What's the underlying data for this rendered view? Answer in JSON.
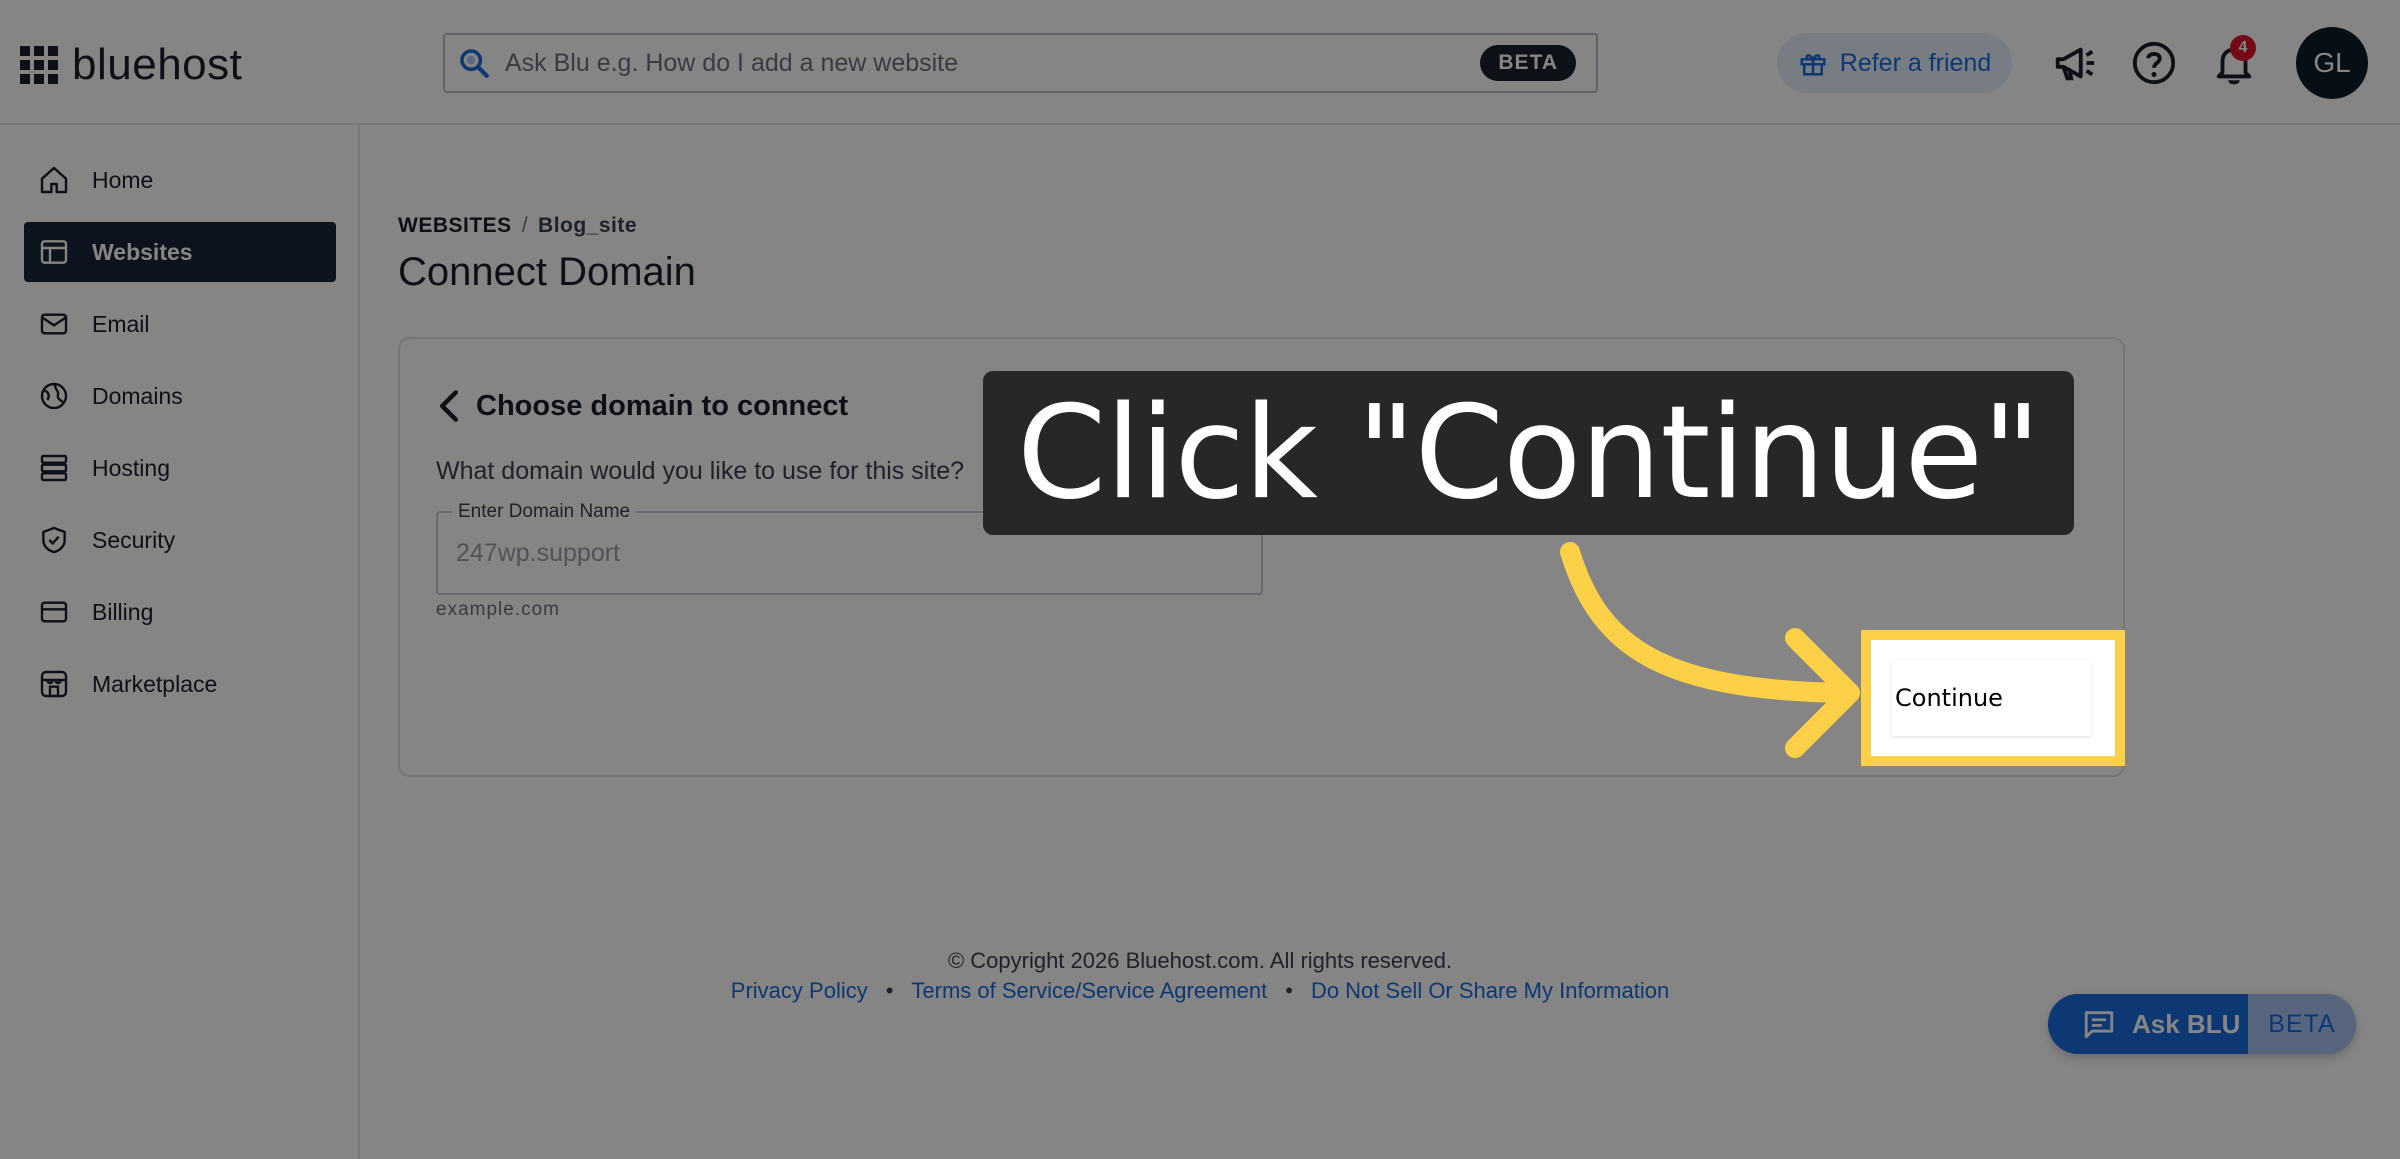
{
  "header": {
    "logo_text": "bluehost",
    "search_placeholder": "Ask Blu e.g. How do I add a new website",
    "search_beta": "BETA",
    "refer_label": "Refer a friend",
    "notification_count": "4",
    "avatar_initials": "GL"
  },
  "sidebar": {
    "items": [
      {
        "label": "Home",
        "icon": "home-icon"
      },
      {
        "label": "Websites",
        "icon": "websites-icon"
      },
      {
        "label": "Email",
        "icon": "email-icon"
      },
      {
        "label": "Domains",
        "icon": "domains-icon"
      },
      {
        "label": "Hosting",
        "icon": "hosting-icon"
      },
      {
        "label": "Security",
        "icon": "shield-icon"
      },
      {
        "label": "Billing",
        "icon": "credit-card-icon"
      },
      {
        "label": "Marketplace",
        "icon": "store-icon"
      }
    ],
    "active": "Websites"
  },
  "main": {
    "breadcrumb": {
      "root": "WEBSITES",
      "separator": "/",
      "current": "Blog_site"
    },
    "title": "Connect Domain",
    "card": {
      "title": "Choose domain to connect",
      "question": "What domain would you like to use for this site?",
      "field_label": "Enter Domain Name",
      "field_value": "247wp.support",
      "helper": "example.com",
      "skip_peek": "e"
    }
  },
  "footer": {
    "copyright": "© Copyright 2026 Bluehost.com. All rights reserved.",
    "links": [
      "Privacy Policy",
      "Terms of Service/Service Agreement",
      "Do Not Sell Or Share My Information"
    ],
    "separator": "•"
  },
  "ask_blu": {
    "label": "Ask BLU",
    "beta": "BETA"
  },
  "overlay": {
    "instruction": "Click \"Continue\"",
    "button_label": "Continue",
    "highlight_color": "#fcd147"
  },
  "colors": {
    "brand_blue": "#196bde",
    "nav_active": "#1a2539",
    "badge_red": "#e0132a"
  }
}
